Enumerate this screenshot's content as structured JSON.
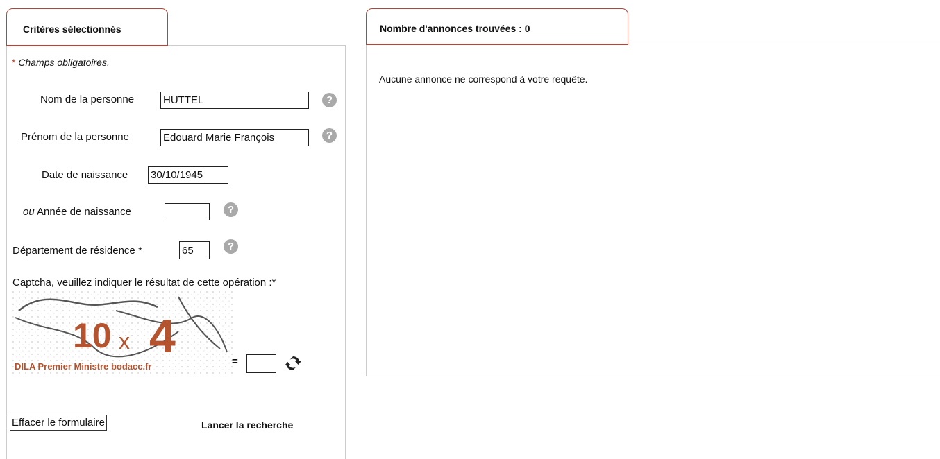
{
  "left_tab": {
    "title": "Critères sélectionnés"
  },
  "right_tab": {
    "title": "Nombre d'annonces trouvées : 0"
  },
  "form": {
    "required_star": "*",
    "required_note": "Champs obligatoires.",
    "nom_label": "Nom de la personne",
    "nom_value": "HUTTEL",
    "prenom_label": "Prénom de la personne",
    "prenom_value": "Edouard Marie François",
    "date_label": "Date de naissance",
    "date_value": "30/10/1945",
    "annee_prefix": "ou",
    "annee_label": "Année de naissance",
    "annee_value": "",
    "dept_label": "Département de résidence *",
    "dept_value": "65",
    "captcha_label": "Captcha, veuillez indiquer le résultat de cette opération :*",
    "captcha_operand_1": "10",
    "captcha_operator": "x",
    "captcha_operand_2": "4",
    "captcha_watermark": "DILA Premier Ministre bodacc.fr",
    "captcha_equals": "=",
    "captcha_answer": "",
    "help_glyph": "?",
    "refresh_icon": "refresh-icon"
  },
  "buttons": {
    "clear": "Effacer le formulaire",
    "search": "Lancer la recherche"
  },
  "results": {
    "message": "Aucune annonce ne correspond à votre requête."
  },
  "colors": {
    "accent": "#b0473a",
    "captcha_text": "#b5532f",
    "help_icon": "#a9a9a9"
  }
}
